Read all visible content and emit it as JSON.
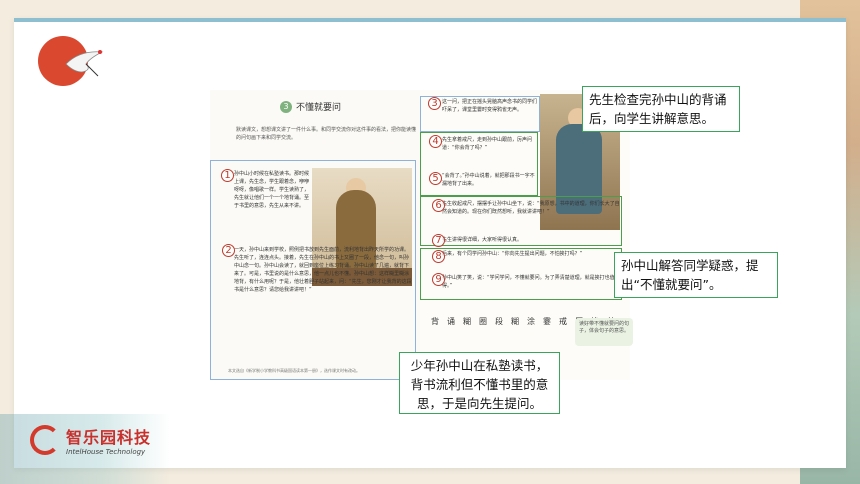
{
  "brand": {
    "name": "智乐园科技",
    "sub": "IntelHouse Technology"
  },
  "lesson": {
    "number": "3",
    "title": "不懂就要问"
  },
  "intro": "默读课文，想想课文讲了一件什么事。和同学交流你对这件事的看法，把你能读懂的问句画下来和同学交流。",
  "paragraphs": {
    "p1": "孙中山小时候在私塾读书。那时候上课，先生念，学生跟着念，咿咿呀呀，像唱歌一样。学生读熟了，先生就让他们一个一个地背诵。至于书里的意思，先生从来不讲。",
    "p2": "一天，孙中山来到学校，照例把书放到先生面前，流利地背出昨天所学的功课。先生听了，连连点头。接着，先生在孙中山的书上又圈了一段，他念一句，叫孙中山念一句。孙中山会读了，就回到座位上练习背诵。孙中山读了几遍，就背下来了。可是，书里说的是什么意思，他一点儿也不懂。孙中山想：这样糊里糊涂地背，有什么用呢？于是，他壮着胆子站起来，问：“先生，您刚才让我背的这段书是什么意思？请您给我讲讲吧！”",
    "p3": "这一问，把正在摇头晃脑高声念书的同学们吓呆了，课堂里霎时变得鸦雀无声。",
    "p4": "先生拿着戒尺，走到孙中山跟前，厉声问道：“你会背了吗？”",
    "p5": "“会背了。”孙中山说着，就把那段书一字不漏地背了出来。",
    "p6": "先生收起戒尺，摆摆手让孙中山坐下，说：“我原想，书中的道理，你们长大了自然会知道的。现在你们既然想听，我就讲讲吧！”",
    "p7": "先生讲得很详细，大家听得很认真。",
    "p8": "后来，有个同学问孙中山：“你向先生提出问题，不怕挨打吗？”",
    "p9": "孙中山笑了笑，说：“学问学问，不懂就要问。为了弄清楚道理，就是挨打也值得。”"
  },
  "markers": [
    "1",
    "2",
    "3",
    "4",
    "5",
    "6",
    "7",
    "8",
    "9"
  ],
  "vocab": [
    "背",
    "诵",
    "糊",
    "圈",
    "段",
    "糊",
    "涂",
    "霎",
    "戒",
    "厉",
    "挨",
    "楚"
  ],
  "vocab_box": "读好带不懂就要问的句子，体会句子的意思。",
  "footnote": "本文选自《新学制小学教科书高级国语读本第一册》，选作课文时有改动。",
  "callouts": {
    "top": "先生检查完孙中山的背诵后，向学生讲解意思。",
    "middle": "孙中山解答同学疑惑，提出“不懂就要问”。",
    "bottom": "少年孙中山在私塾读书，背书流利但不懂书里的意思，于是向先生提问。"
  }
}
